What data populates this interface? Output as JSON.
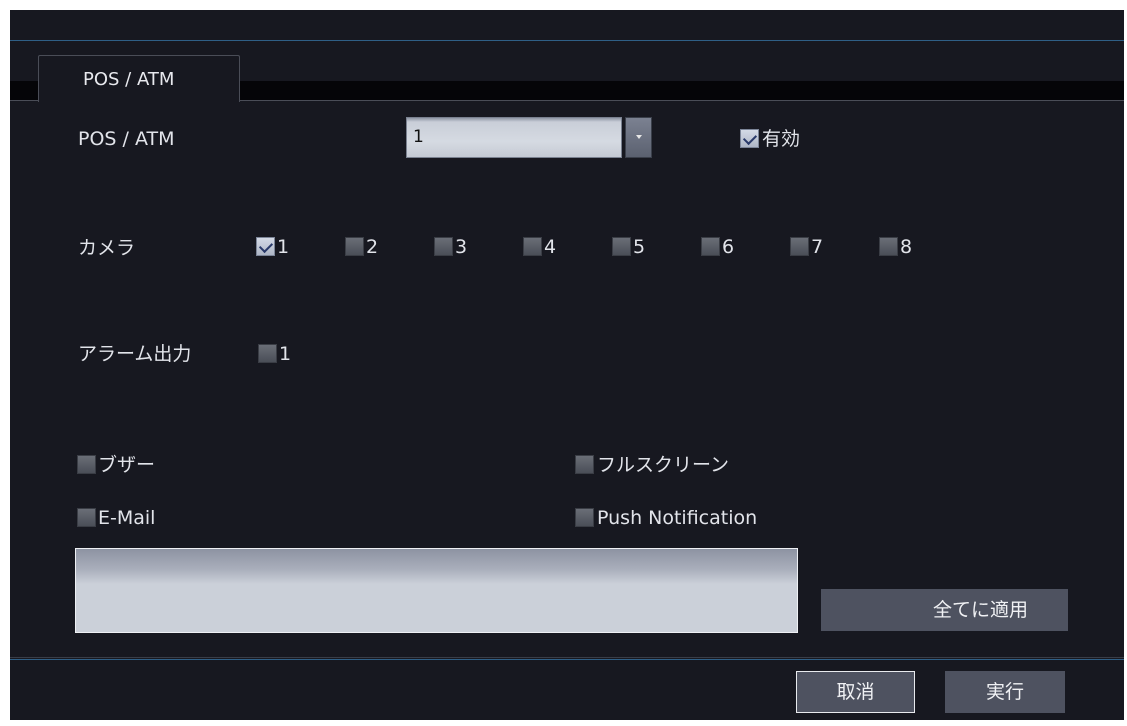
{
  "tab": {
    "label": "POS / ATM"
  },
  "pos": {
    "label": "POS / ATM",
    "select_value": "1",
    "enabled_label": "有効",
    "enabled_checked": true
  },
  "camera": {
    "label": "カメラ",
    "items": [
      {
        "label": "1",
        "checked": true
      },
      {
        "label": "2",
        "checked": false
      },
      {
        "label": "3",
        "checked": false
      },
      {
        "label": "4",
        "checked": false
      },
      {
        "label": "5",
        "checked": false
      },
      {
        "label": "6",
        "checked": false
      },
      {
        "label": "7",
        "checked": false
      },
      {
        "label": "8",
        "checked": false
      }
    ]
  },
  "alarm_output": {
    "label": "アラーム出力",
    "items": [
      {
        "label": "1",
        "checked": false
      }
    ]
  },
  "actions": {
    "buzzer": "ブザー",
    "fullscreen": "フルスクリーン",
    "email": "E-Mail",
    "push": "Push Notification"
  },
  "buttons": {
    "apply_all": "全てに適用",
    "cancel": "取消",
    "execute": "実行"
  },
  "colors": {
    "background": "#171820",
    "accent_line": "#2f5f86",
    "button": "#4e5260"
  }
}
